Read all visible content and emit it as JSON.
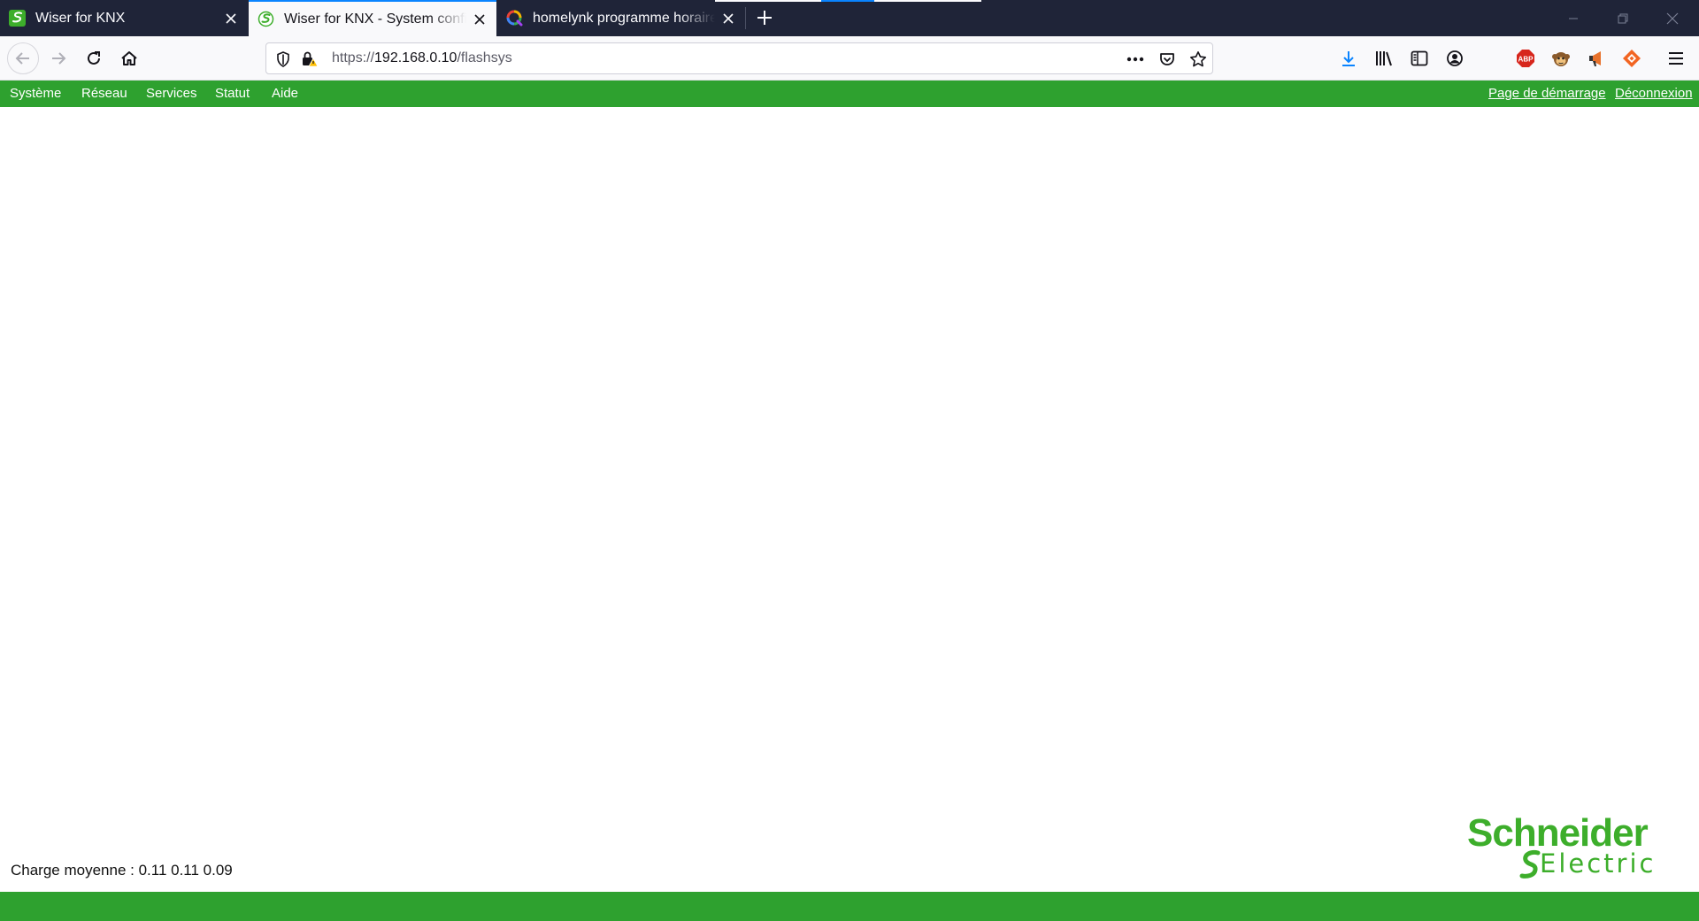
{
  "browser": {
    "tabs": [
      {
        "title": "Wiser for KNX",
        "icon": "schneider-favicon",
        "active": false
      },
      {
        "title": "Wiser for KNX - System configuration",
        "icon": "schneider-favicon",
        "active": true
      },
      {
        "title": "homelynk programme horaire",
        "icon": "search-engine-favicon",
        "active": false
      }
    ],
    "url": {
      "scheme": "https://",
      "host": "192.168.0.10",
      "path": "/flashsys"
    },
    "accent_color": "#0a84ff"
  },
  "app": {
    "menu": [
      "Système",
      "Réseau",
      "Services",
      "Statut",
      "Aide"
    ],
    "links": {
      "start_page": "Page de démarrage",
      "logout": "Déconnexion"
    },
    "load_average": "Charge moyenne : 0.11 0.11 0.09",
    "logo": {
      "line1": "Schneider",
      "line2": "Electric"
    },
    "brand_color": "#2ea12f"
  }
}
